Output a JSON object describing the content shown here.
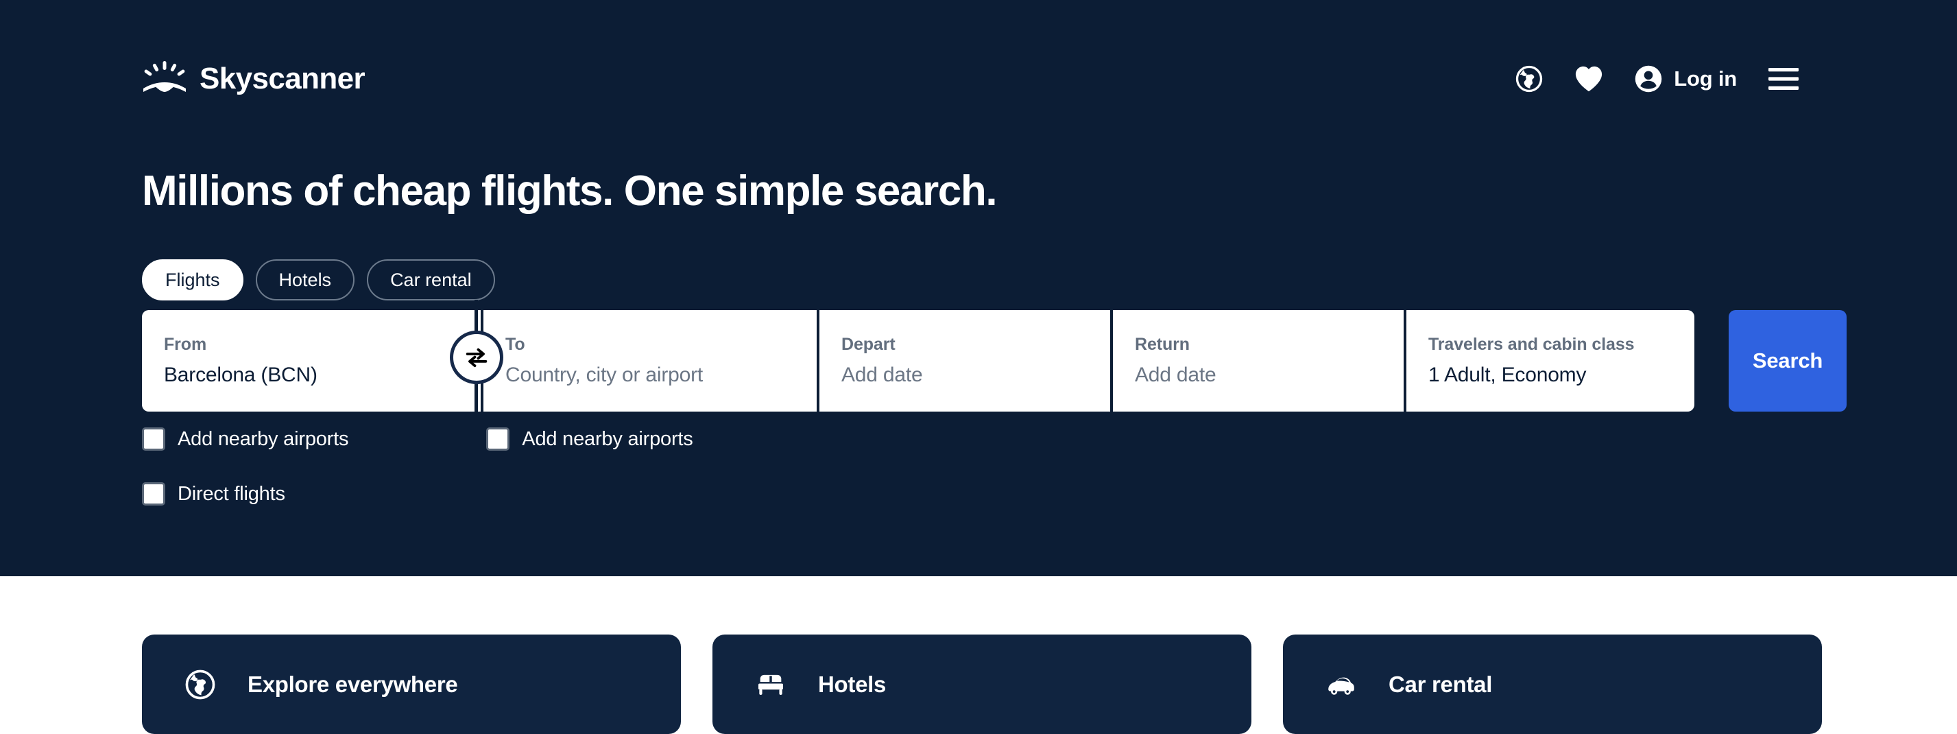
{
  "brand": {
    "name": "Skyscanner",
    "logo_icon": "sunburst-icon"
  },
  "header": {
    "globe_icon": "globe-icon",
    "favorites_icon": "heart-icon",
    "account_icon": "person-circle-icon",
    "login_label": "Log in",
    "menu_icon": "hamburger-menu-icon"
  },
  "hero": {
    "headline": "Millions of cheap flights. One simple search."
  },
  "tabs": [
    {
      "label": "Flights",
      "active": true
    },
    {
      "label": "Hotels",
      "active": false
    },
    {
      "label": "Car rental",
      "active": false
    }
  ],
  "search": {
    "from": {
      "label": "From",
      "value": "Barcelona (BCN)"
    },
    "to": {
      "label": "To",
      "placeholder": "Country, city or airport"
    },
    "depart": {
      "label": "Depart",
      "placeholder": "Add date"
    },
    "return": {
      "label": "Return",
      "placeholder": "Add date"
    },
    "travelers": {
      "label": "Travelers and cabin class",
      "value": "1 Adult, Economy"
    },
    "swap_icon": "swap-arrows-icon",
    "search_label": "Search"
  },
  "options": {
    "from_nearby": {
      "label": "Add nearby airports",
      "checked": false
    },
    "to_nearby": {
      "label": "Add nearby airports",
      "checked": false
    },
    "direct": {
      "label": "Direct flights",
      "checked": false
    }
  },
  "cards": [
    {
      "label": "Explore everywhere",
      "icon": "globe-icon"
    },
    {
      "label": "Hotels",
      "icon": "bed-icon"
    },
    {
      "label": "Car rental",
      "icon": "car-icon"
    }
  ],
  "colors": {
    "hero_bg": "#0c1d35",
    "card_bg": "#102440",
    "accent_blue": "#2f62e0",
    "field_bg": "#ffffff",
    "label_gray": "#626e7e",
    "placeholder_gray": "#6b7685"
  }
}
